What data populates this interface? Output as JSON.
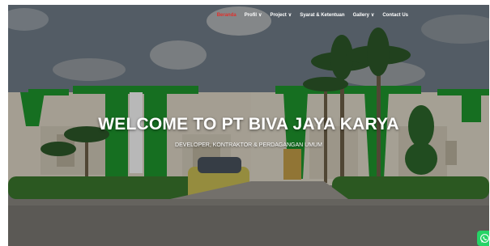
{
  "nav": {
    "items": [
      {
        "label": "Beranda",
        "has_dropdown": false,
        "active": true
      },
      {
        "label": "Profil",
        "has_dropdown": true,
        "active": false
      },
      {
        "label": "Project",
        "has_dropdown": true,
        "active": false
      },
      {
        "label": "Syarat & Ketentuan",
        "has_dropdown": false,
        "active": false
      },
      {
        "label": "Gallery",
        "has_dropdown": true,
        "active": false
      },
      {
        "label": "Contact Us",
        "has_dropdown": false,
        "active": false
      }
    ],
    "active_color": "#e0302b",
    "text_color": "#ffffff"
  },
  "hero": {
    "title": "WELCOME TO PT BIVA JAYA KARYA",
    "subtitle": "DEVELOPER, KONTRAKTOR & PERDAGANGAN UMUM"
  },
  "whatsapp": {
    "icon": "whatsapp-icon",
    "color": "#25d366"
  },
  "colors": {
    "house_green": "#1f9a2e",
    "house_wall": "#e6e0d0",
    "roof": "#5a5a5a",
    "car": "#d8cc5a",
    "door": "#c9a24a"
  }
}
